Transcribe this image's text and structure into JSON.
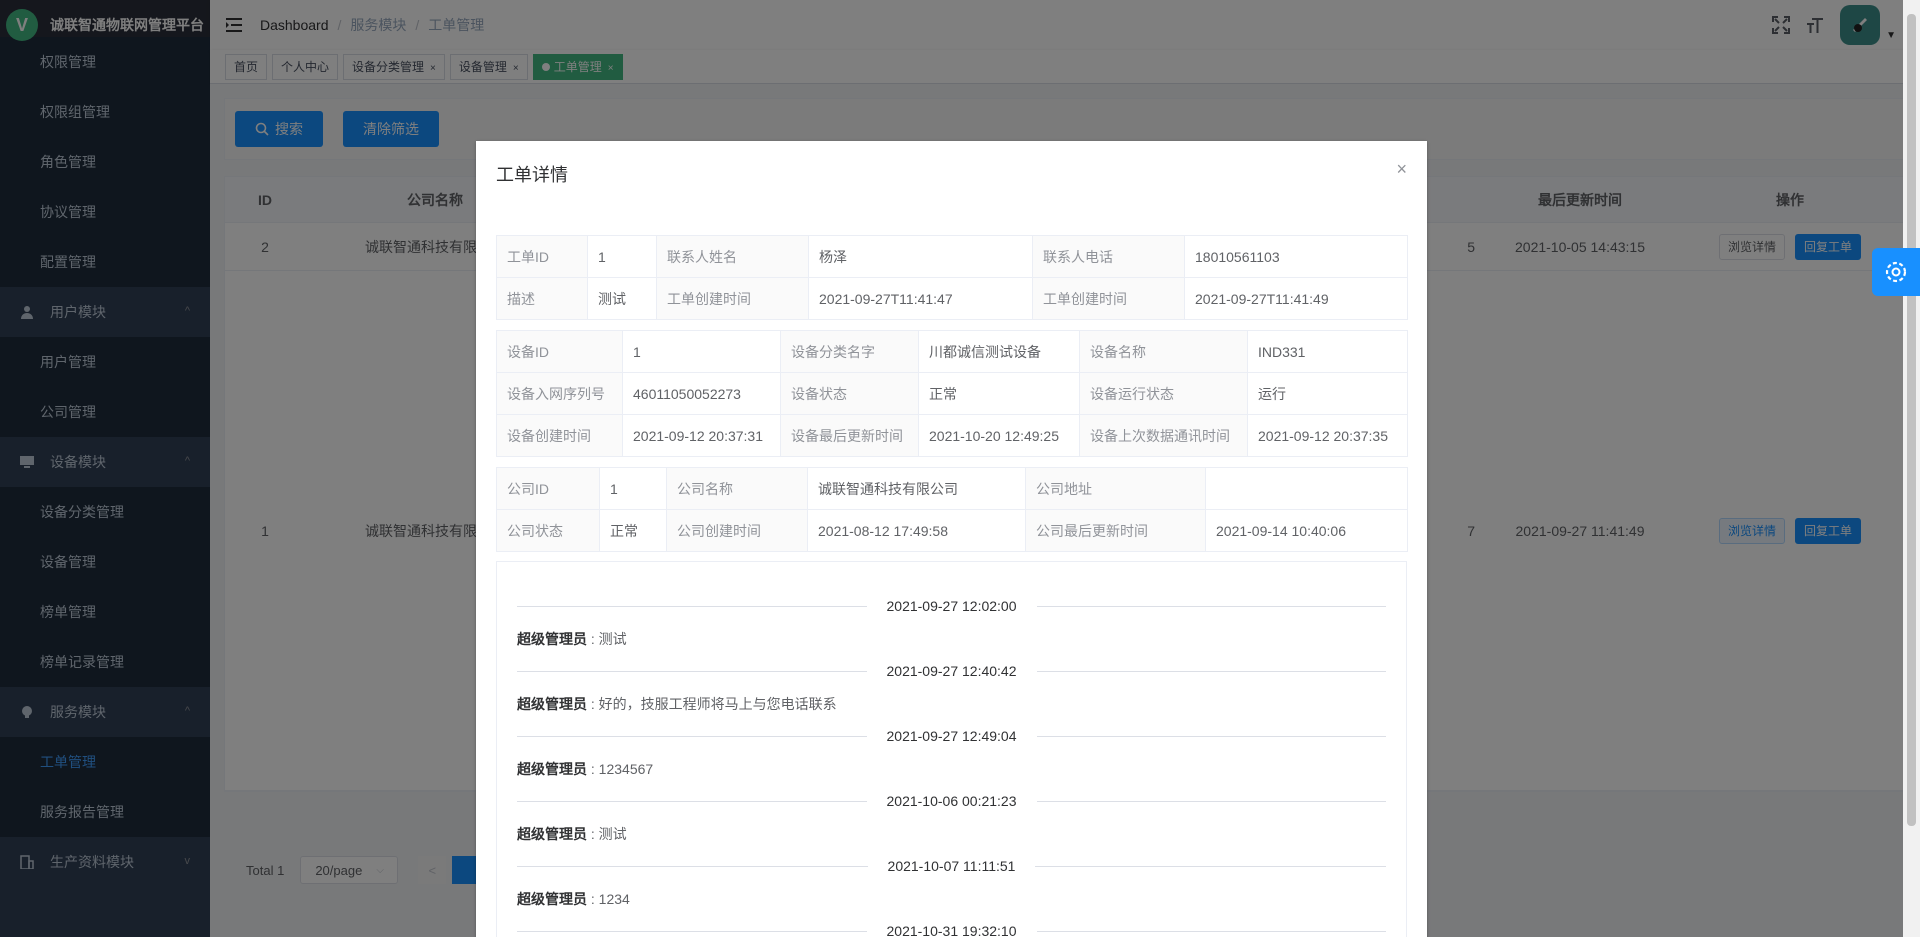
{
  "app": {
    "title": "诚联智通物联网管理平台",
    "logo_letter": "V"
  },
  "sidebar": {
    "items": [
      {
        "label": "权限管理",
        "type": "sub"
      },
      {
        "label": "权限组管理",
        "type": "sub"
      },
      {
        "label": "角色管理",
        "type": "sub"
      },
      {
        "label": "协议管理",
        "type": "sub"
      },
      {
        "label": "配置管理",
        "type": "sub"
      },
      {
        "label": "用户模块",
        "type": "group",
        "icon": "user-icon",
        "chevron": "^"
      },
      {
        "label": "用户管理",
        "type": "sub"
      },
      {
        "label": "公司管理",
        "type": "sub"
      },
      {
        "label": "设备模块",
        "type": "group",
        "icon": "monitor-icon",
        "chevron": "^"
      },
      {
        "label": "设备分类管理",
        "type": "sub"
      },
      {
        "label": "设备管理",
        "type": "sub"
      },
      {
        "label": "榜单管理",
        "type": "sub"
      },
      {
        "label": "榜单记录管理",
        "type": "sub"
      },
      {
        "label": "服务模块",
        "type": "group",
        "icon": "bulb-icon",
        "chevron": "^"
      },
      {
        "label": "工单管理",
        "type": "sub",
        "active": true
      },
      {
        "label": "服务报告管理",
        "type": "sub"
      },
      {
        "label": "生产资料模块",
        "type": "group",
        "icon": "building-icon",
        "chevron": "v"
      }
    ]
  },
  "navbar": {
    "breadcrumb": [
      "Dashboard",
      "服务模块",
      "工单管理"
    ],
    "separator": "/"
  },
  "tags": [
    {
      "label": "首页",
      "closable": false,
      "active": false
    },
    {
      "label": "个人中心",
      "closable": false,
      "active": false
    },
    {
      "label": "设备分类管理",
      "closable": true,
      "active": false
    },
    {
      "label": "设备管理",
      "closable": true,
      "active": false
    },
    {
      "label": "工单管理",
      "closable": true,
      "active": true
    }
  ],
  "filter": {
    "search_label": "搜索",
    "clear_label": "清除筛选"
  },
  "table": {
    "headers": {
      "id": "ID",
      "company": "公司名称",
      "updated": "最后更新时间",
      "ops": "操作"
    },
    "rows": [
      {
        "id": "2",
        "company": "诚联智通科技有限公司",
        "mid": "5",
        "updated": "2021-10-05 14:43:15",
        "view": "浏览详情",
        "reply": "回复工单"
      },
      {
        "id": "1",
        "company": "诚联智通科技有限公司",
        "mid": "7",
        "updated": "2021-09-27 11:41:49",
        "view": "浏览详情",
        "reply": "回复工单"
      }
    ]
  },
  "pagination": {
    "total": "Total 1",
    "page_size": "20/page",
    "prev": "<"
  },
  "dialog": {
    "title": "工单详情",
    "close": "×",
    "ticket": [
      [
        {
          "l": "工单ID"
        },
        {
          "v": "1"
        },
        {
          "l": "联系人姓名"
        },
        {
          "v": "杨泽"
        },
        {
          "l": "联系人电话"
        },
        {
          "v": "18010561103"
        }
      ],
      [
        {
          "l": "描述"
        },
        {
          "v": "测试"
        },
        {
          "l": "工单创建时间"
        },
        {
          "v": "2021-09-27T11:41:47"
        },
        {
          "l": "工单创建时间"
        },
        {
          "v": "2021-09-27T11:41:49"
        }
      ]
    ],
    "device": [
      [
        {
          "l": "设备ID"
        },
        {
          "v": "1"
        },
        {
          "l": "设备分类名字"
        },
        {
          "v": "川都诚信测试设备"
        },
        {
          "l": "设备名称"
        },
        {
          "v": "IND331"
        }
      ],
      [
        {
          "l": "设备入网序列号"
        },
        {
          "v": "46011050052273"
        },
        {
          "l": "设备状态"
        },
        {
          "v": "正常"
        },
        {
          "l": "设备运行状态"
        },
        {
          "v": "运行"
        }
      ],
      [
        {
          "l": "设备创建时间"
        },
        {
          "v": "2021-09-12 20:37:31"
        },
        {
          "l": "设备最后更新时间"
        },
        {
          "v": "2021-10-20 12:49:25"
        },
        {
          "l": "设备上次数据通讯时间"
        },
        {
          "v": "2021-09-12 20:37:35"
        }
      ]
    ],
    "company": [
      [
        {
          "l": "公司ID"
        },
        {
          "v": "1"
        },
        {
          "l": "公司名称"
        },
        {
          "v": "诚联智通科技有限公司"
        },
        {
          "l": "公司地址"
        },
        {
          "v": ""
        }
      ],
      [
        {
          "l": "公司状态"
        },
        {
          "v": "正常"
        },
        {
          "l": "公司创建时间"
        },
        {
          "v": "2021-08-12 17:49:58"
        },
        {
          "l": "公司最后更新时间"
        },
        {
          "v": "2021-09-14 10:40:06"
        }
      ]
    ],
    "messages": [
      {
        "time": "2021-09-27 12:02:00",
        "author": "超级管理员",
        "text": "测试"
      },
      {
        "time": "2021-09-27 12:40:42",
        "author": "超级管理员",
        "text": "好的，技服工程师将马上与您电话联系"
      },
      {
        "time": "2021-09-27 12:49:04",
        "author": "超级管理员",
        "text": "1234567"
      },
      {
        "time": "2021-10-06 00:21:23",
        "author": "超级管理员",
        "text": "测试"
      },
      {
        "time": "2021-10-07 11:11:51",
        "author": "超级管理员",
        "text": "1234"
      },
      {
        "time": "2021-10-31 19:32:10",
        "author": "",
        "text": ""
      }
    ],
    "message_sep": " : "
  },
  "colors": {
    "primary": "#1890ff",
    "sidebar": "#304156",
    "active_tag": "#42b983"
  }
}
